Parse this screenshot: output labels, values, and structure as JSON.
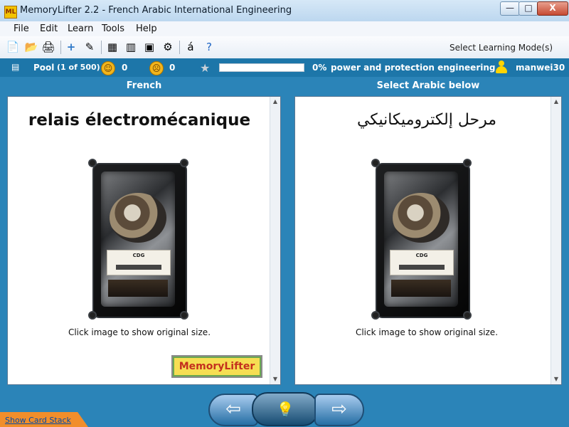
{
  "window": {
    "app_icon_text": "ML",
    "title": "MemoryLifter 2.2 - French Arabic International Engineering",
    "minimize": "—",
    "maximize": "□",
    "close": "X"
  },
  "menu": {
    "items": [
      "File",
      "Edit",
      "Learn",
      "Tools",
      "Help"
    ]
  },
  "toolbar": {
    "icons": [
      "new-icon",
      "open-icon",
      "print-icon",
      "add-icon",
      "edit-icon",
      "presentation-icon",
      "card-stack-icon",
      "learning-box-icon",
      "settings-icon",
      "special-character-icon",
      "help-icon"
    ],
    "select_mode_label": "Select Learning Mode(s)"
  },
  "status": {
    "pool_label": "Pool",
    "pool_count": "(1 of 500)",
    "correct_count": "0",
    "wrong_count": "0",
    "progress_percent": 0,
    "progress_text": "0%",
    "dictionary": "power and protection engineering",
    "username": "manwei30"
  },
  "panels": {
    "left": {
      "header": "French",
      "word": "relais électromécanique",
      "caption": "Click image to show original size.",
      "logo_text": "MemoryLifter"
    },
    "right": {
      "header": "Select Arabic below",
      "word": "مرحل إلكتروميكانيكي",
      "caption": "Click image to show original size."
    }
  },
  "relay_image": {
    "label": "CDG"
  },
  "navigation": {
    "back_icon": "⇦",
    "hint_icon": "💡",
    "forward_icon": "⇨"
  },
  "footer": {
    "show_card_stack": "Show Card Stack"
  }
}
